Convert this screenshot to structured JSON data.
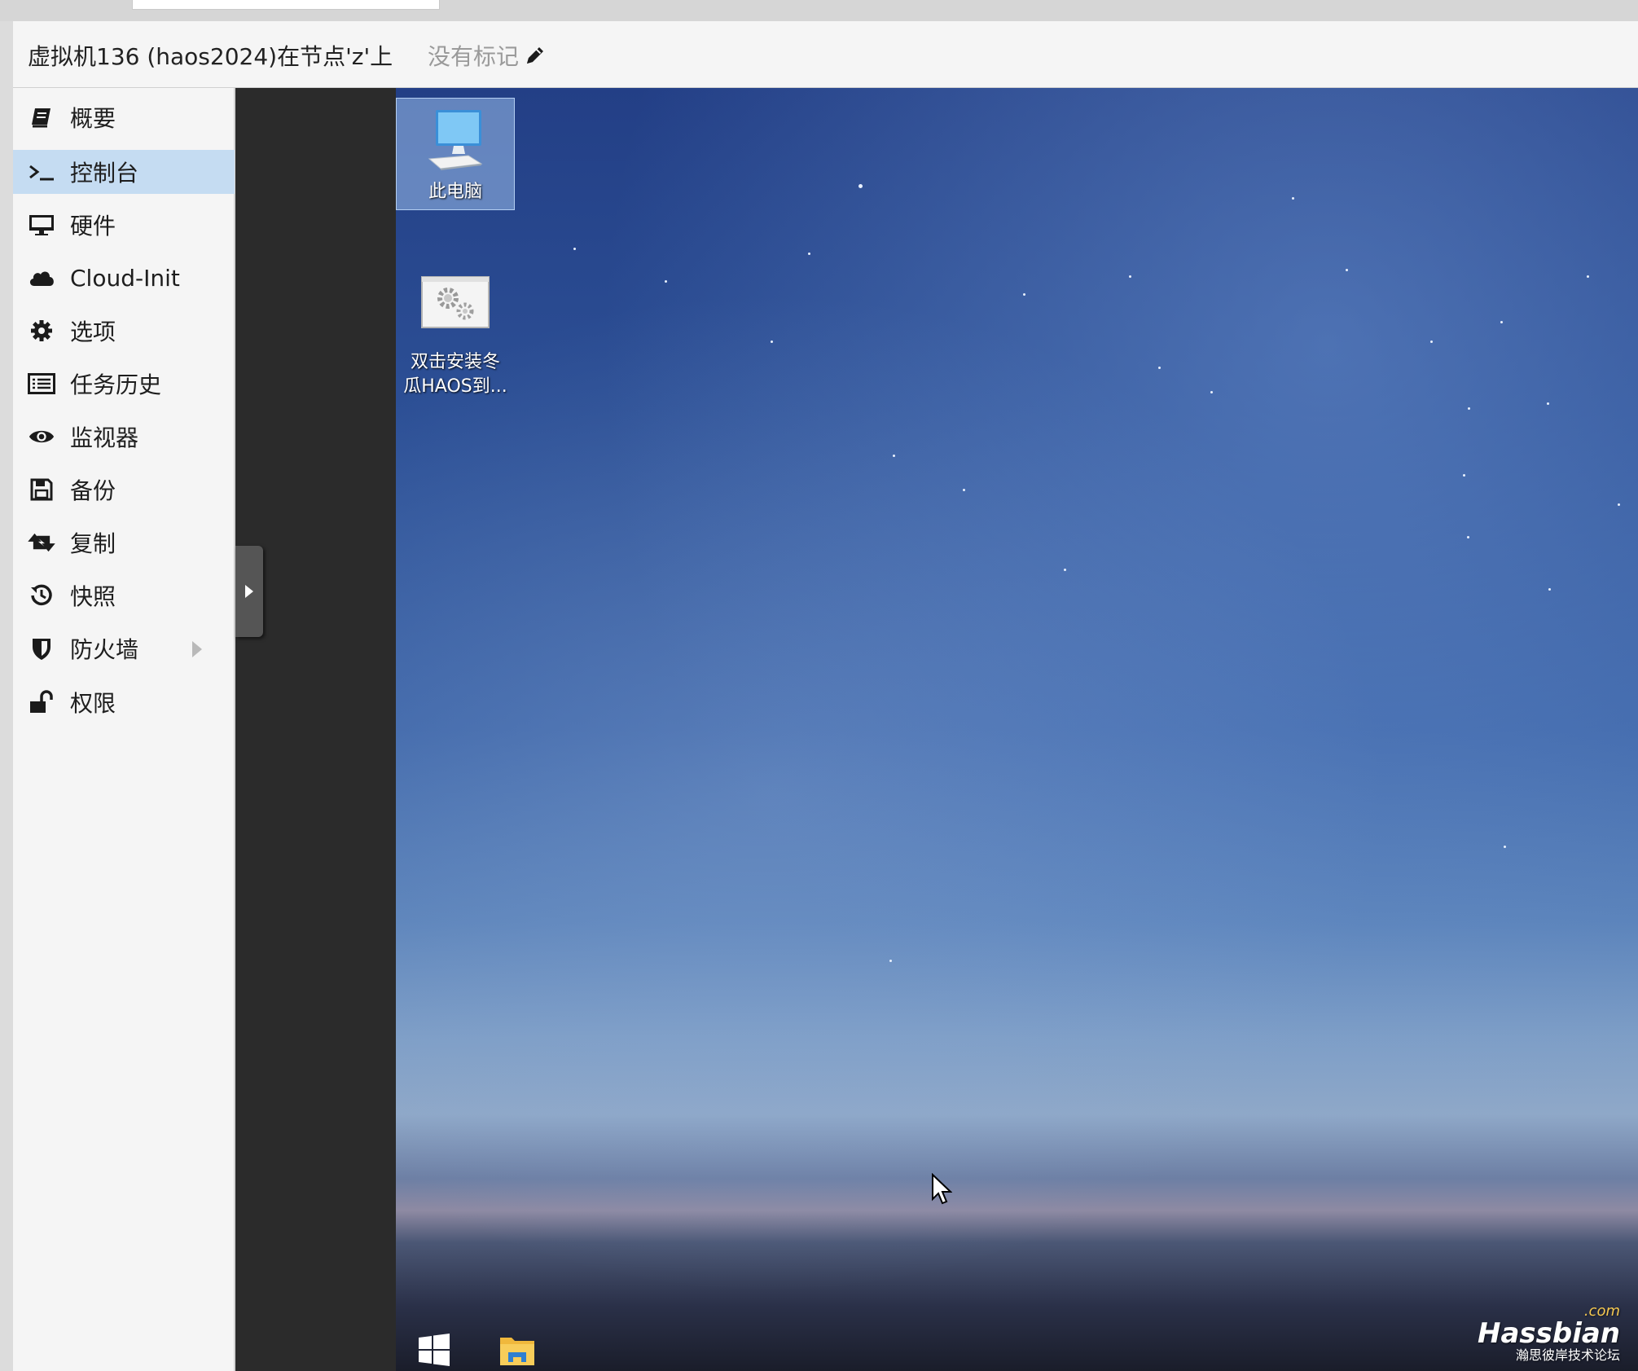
{
  "header": {
    "title": "虚拟机136 (haos2024)在节点'z'上",
    "no_tags": "没有标记"
  },
  "sidebar": {
    "items": [
      {
        "label": "概要",
        "icon": "book-icon"
      },
      {
        "label": "控制台",
        "icon": "terminal-icon",
        "active": true
      },
      {
        "label": "硬件",
        "icon": "desktop-icon"
      },
      {
        "label": "Cloud-Init",
        "icon": "cloud-icon"
      },
      {
        "label": "选项",
        "icon": "gear-icon"
      },
      {
        "label": "任务历史",
        "icon": "list-icon"
      },
      {
        "label": "监视器",
        "icon": "eye-icon"
      },
      {
        "label": "备份",
        "icon": "floppy-disk-icon"
      },
      {
        "label": "复制",
        "icon": "retweet-icon"
      },
      {
        "label": "快照",
        "icon": "history-icon"
      },
      {
        "label": "防火墙",
        "icon": "shield-icon",
        "expandable": true
      },
      {
        "label": "权限",
        "icon": "unlock-icon"
      }
    ],
    "active_color": "#c5dcf2"
  },
  "desktop": {
    "icons": [
      {
        "label": "此电脑",
        "icon": "computer-icon",
        "selected": true
      },
      {
        "label_line1": "双击安装冬",
        "label_line2": "瓜HAOS到...",
        "icon": "setup-gears-icon"
      }
    ],
    "taskbar": [
      "windows-start-icon",
      "file-explorer-icon"
    ]
  },
  "watermark": {
    "com": ".com",
    "main": "Hassbian",
    "sub": "瀚思彼岸技术论坛"
  }
}
